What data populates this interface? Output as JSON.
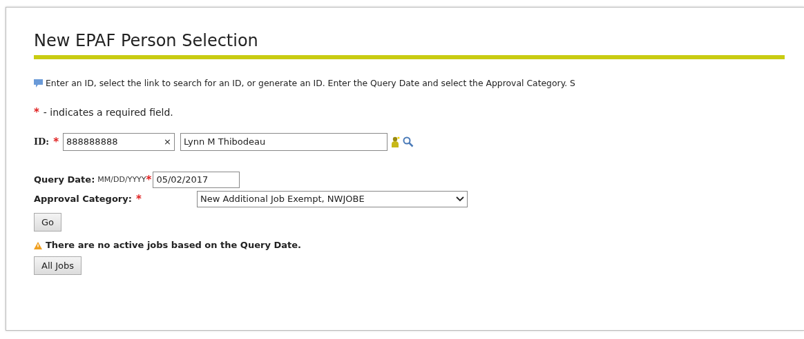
{
  "page": {
    "title": "New EPAF Person Selection"
  },
  "instructions": "Enter an ID, select the link to search for an ID, or generate an ID. Enter the Query Date and select the Approval Category. S",
  "required_note": {
    "mark": "*",
    "text": "- indicates a required field."
  },
  "id_field": {
    "label": "ID:",
    "required_mark": "*",
    "value": "888888888",
    "clear": "×",
    "name_value": "Lynn M Thibodeau"
  },
  "query_date": {
    "label": "Query Date:",
    "hint": "MM/DD/YYYY",
    "required_mark": "*",
    "value": "05/02/2017"
  },
  "approval_category": {
    "label": "Approval Category:",
    "required_mark": "*",
    "value": "New Additional Job Exempt, NWJOBE"
  },
  "go_button": "Go",
  "warning": "There are no active jobs based on the Query Date.",
  "all_jobs_button": "All Jobs"
}
